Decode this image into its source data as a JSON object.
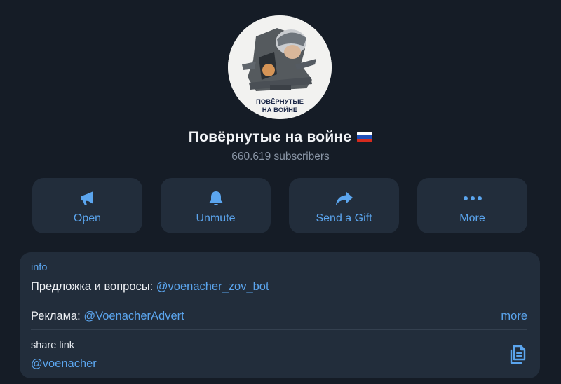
{
  "channel": {
    "name": "Повёрнутые на войне",
    "subscribers": "660.619 subscribers",
    "avatar_caption_line1": "ПОВЁРНУТЫЕ",
    "avatar_caption_line2": "НА ВОЙНЕ"
  },
  "actions": [
    {
      "label": "Open",
      "icon": "megaphone-icon"
    },
    {
      "label": "Unmute",
      "icon": "bell-icon"
    },
    {
      "label": "Send a Gift",
      "icon": "share-arrow-icon"
    },
    {
      "label": "More",
      "icon": "more-dots-icon"
    }
  ],
  "info": {
    "label": "info",
    "line1_text": "Предложка и вопросы: ",
    "line1_link": "@voenacher_zov_bot",
    "line2_text": "Реклама: ",
    "line2_link": "@VoenacherAdvert",
    "more": "more"
  },
  "share": {
    "label": "share link",
    "value": "@voenacher"
  },
  "colors": {
    "background": "#151c26",
    "card": "#222d3b",
    "accent": "#5ba5ee",
    "muted": "#8a96a6"
  }
}
